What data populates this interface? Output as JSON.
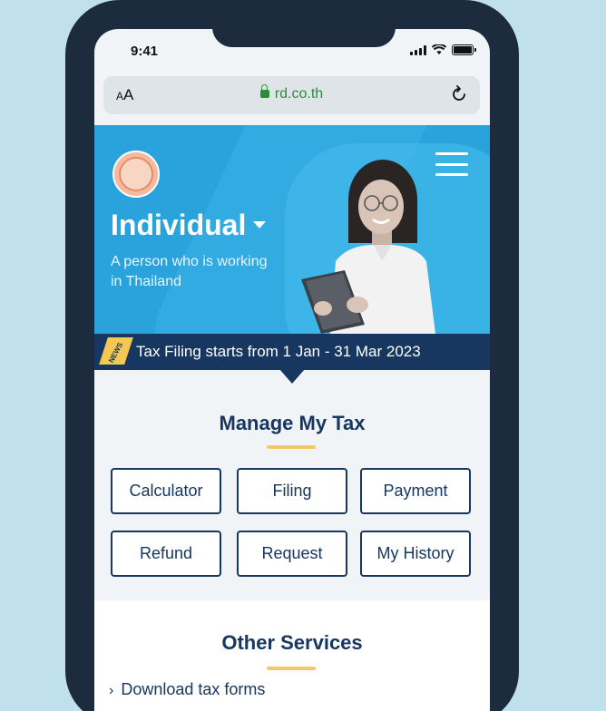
{
  "status_bar": {
    "time": "9:41"
  },
  "browser": {
    "text_size_label_small": "A",
    "text_size_label_large": "A",
    "url": "rd.co.th"
  },
  "hero": {
    "title": "Individual",
    "subtitle_line1": "A person who is working",
    "subtitle_line2": "in Thailand"
  },
  "news": {
    "tag": "NEWS",
    "text": "Tax Filing starts from 1 Jan - 31 Mar 2023"
  },
  "manage": {
    "title": "Manage My Tax",
    "tiles": [
      {
        "label": "Calculator"
      },
      {
        "label": "Filing"
      },
      {
        "label": "Payment"
      },
      {
        "label": "Refund"
      },
      {
        "label": "Request"
      },
      {
        "label": "My History"
      }
    ]
  },
  "other_services": {
    "title": "Other Services",
    "links": [
      {
        "label": "Download tax forms"
      }
    ]
  },
  "colors": {
    "navy": "#173760",
    "hero_blue": "#2aa3dd",
    "accent_yellow": "#f1c86a",
    "frame": "#1c2b3d",
    "background": "#bfe0ec"
  }
}
